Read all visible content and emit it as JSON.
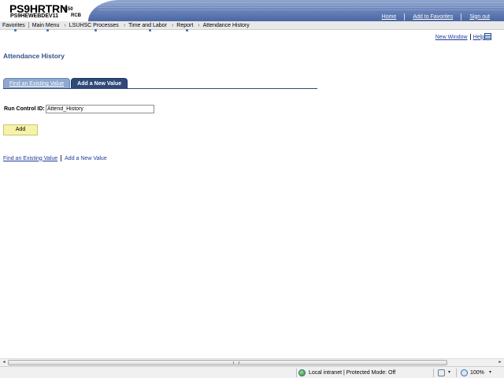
{
  "header": {
    "app_name": "PS9HRTRN",
    "version": "8.50",
    "server": "PS9HEWEBDEV11",
    "user": "RCB",
    "links": [
      "Home",
      "Add to Favorites",
      "Sign out"
    ]
  },
  "nav": {
    "favorites": "Favorites",
    "main_menu": "Main Menu",
    "breadcrumbs": [
      "LSUHSC Processes",
      "Time and Labor",
      "Report",
      "Attendance History"
    ],
    "separator": "›"
  },
  "pagelinks": {
    "new_window": "New Window",
    "help": "Help",
    "icon": "customize-page-icon"
  },
  "page": {
    "title": "Attendance History",
    "tabs": [
      {
        "label": "Find an Existing Value",
        "active": false
      },
      {
        "label": "Add a New Value",
        "active": true
      }
    ],
    "run_control_label": "Run Control ID:",
    "run_control_value": "Attend_History",
    "add_button": "Add",
    "bottom_links": {
      "find_existing": "Find an Existing Value",
      "add_new": "Add a New Value"
    }
  },
  "scrollbar": {
    "left_arrow": "◂",
    "right_arrow": "▸"
  },
  "statusbar": {
    "zone_text": "Local intranet | Protected Mode: Off",
    "zone_icon": "globe-icon",
    "zoom": "100%",
    "dropdown": "▾"
  },
  "colors": {
    "header_band": "#4a66a3",
    "tab_active": "#2f4a7a",
    "tab_inactive": "#8fa8cf",
    "title": "#31508a",
    "link": "#1f3c9c",
    "add_button": "#f6f3a9"
  }
}
